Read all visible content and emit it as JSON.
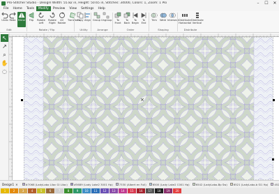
{
  "window": {
    "title": "Pro-Stitcher Studio - Designl Width: 55.82 in, Height: 50.65 in, Stitches: 34000, Colors: 1, Zoom: 1 Plo",
    "minimize": "–",
    "maximize": "☐",
    "close": "✕"
  },
  "menu": [
    "File",
    "Home",
    "Tools",
    "Modify",
    "Preview",
    "View",
    "Settings",
    "Help"
  ],
  "menu_active_index": 3,
  "ribbon": {
    "tools": [
      {
        "label": "Undo",
        "icon": "undo-icon"
      },
      {
        "label": "Redo",
        "icon": "redo-icon"
      },
      {
        "label": "Mirror",
        "icon": "mirror-icon",
        "active": true
      },
      {
        "label": "Flip",
        "icon": "flip-icon"
      },
      {
        "label": "Rotate Left",
        "icon": "rotate-left-icon"
      },
      {
        "label": "Rotate Right",
        "icon": "rotate-right-icon"
      },
      {
        "label": "All Rotate",
        "icon": "all-rotate-icon"
      },
      {
        "label": "Transform",
        "icon": "transform-icon"
      },
      {
        "label": "Copy",
        "icon": "copy-icon"
      },
      {
        "label": "Align",
        "icon": "align-icon"
      },
      {
        "label": "Group",
        "icon": "group-icon"
      },
      {
        "label": "Ungroup",
        "icon": "ungroup-icon"
      },
      {
        "label": "To Front",
        "icon": "to-front-icon"
      },
      {
        "label": "To Back",
        "icon": "to-back-icon"
      },
      {
        "label": "To Begin",
        "icon": "to-begin-icon"
      },
      {
        "label": "To End",
        "icon": "to-end-icon"
      },
      {
        "label": "Trim",
        "icon": "trim-icon"
      },
      {
        "label": "Weld",
        "icon": "weld-icon"
      },
      {
        "label": "Intersect",
        "icon": "intersect-icon"
      },
      {
        "label": "Distribute Horizontal",
        "icon": "distribute-horizontal-icon"
      },
      {
        "label": "Distribute Vertical",
        "icon": "distribute-vertical-icon"
      }
    ],
    "groups": [
      "Edit",
      "Rotate / Flip",
      "Utility",
      "Arrange",
      "Order",
      "Shaping",
      "Distribute"
    ]
  },
  "left_tools": [
    {
      "name": "select-arrow-icon",
      "glyph": "↖",
      "active": true
    },
    {
      "name": "node-edit-icon",
      "glyph": "↗"
    },
    {
      "name": "zoom-icon",
      "glyph": "⌕"
    },
    {
      "name": "pan-hand-icon",
      "glyph": "✋"
    },
    {
      "name": "lasso-icon",
      "glyph": "◌"
    }
  ],
  "design_tab": "Design1",
  "design_tab_close": "×",
  "threads": [
    {
      "color": "#b9a9d9",
      "label": "#7068 (LadyLabo Lilac Gl Lilac)"
    },
    {
      "color": "#9a8fcf",
      "label": "#5689 (Lady Lake2 3001 Hp)"
    },
    {
      "color": "#c9c2e6",
      "label": "7330 (Albert en Full)"
    },
    {
      "color": "#a8c8e0",
      "label": "6500 (Lady Lake2 C001 Hp)"
    },
    {
      "color": "#cfe0c8",
      "label": "6542 (LadyLabo-Bp Sw)"
    },
    {
      "color": "#e6dcc0",
      "label": "6521 (LadyLabo-b Sl1 Hp)"
    },
    {
      "color": "#d9c6e8",
      "label": "45218 (LadyLabo1-3522 Hp)"
    },
    {
      "color": "#bfb3e0",
      "label": "15556 (Lady Lake2 3522 Hp)"
    }
  ],
  "palette": [
    {
      "color": "#e6b800",
      "label": "1"
    },
    {
      "color": "#e38a0c",
      "label": "2"
    },
    {
      "color": "#d7a64c",
      "label": "3"
    },
    {
      "color": "#b45f2a",
      "label": "4"
    },
    {
      "color": "#c7c02a",
      "label": "5"
    },
    {
      "color": "#9a6b3b",
      "label": "6"
    },
    {
      "color": "#cfcfcf",
      "label": "7"
    },
    {
      "color": "#3a8f2f",
      "label": "8"
    },
    {
      "color": "#2d9a6a",
      "label": "9"
    },
    {
      "color": "#3f8fc7",
      "label": "10"
    },
    {
      "color": "#2b6fb8",
      "label": "11"
    },
    {
      "color": "#6a4fb5",
      "label": "12"
    },
    {
      "color": "#8a4aa8",
      "label": "13"
    },
    {
      "color": "#c0398f",
      "label": "14"
    },
    {
      "color": "#d9384f",
      "label": "15"
    },
    {
      "color": "#a31f2a",
      "label": "16"
    },
    {
      "color": "#555555",
      "label": "17"
    },
    {
      "color": "#1e1e1e",
      "label": "18"
    },
    {
      "color": "#8a2e6b",
      "label": "19"
    },
    {
      "color": "#e43e3e",
      "label": "20"
    }
  ],
  "colors": {
    "accent": "#2e7a3c",
    "quilt_base": "#eef2ea",
    "quilt_stitch": "#7d6fd0",
    "quilt_band": "#cdd7c9"
  }
}
